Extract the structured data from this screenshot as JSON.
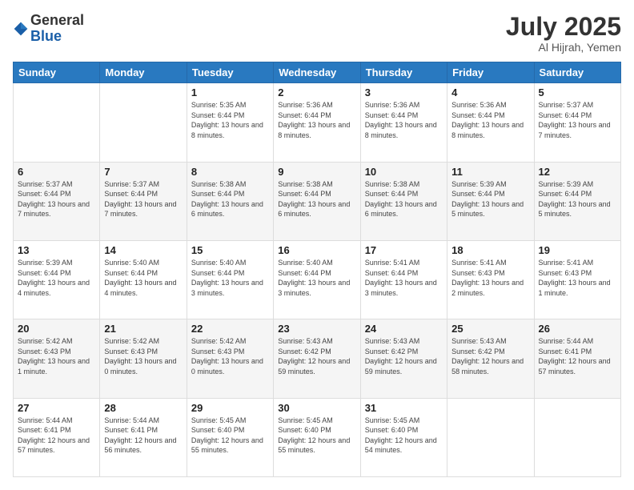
{
  "header": {
    "logo_general": "General",
    "logo_blue": "Blue",
    "month_year": "July 2025",
    "location": "Al Hijrah, Yemen"
  },
  "calendar": {
    "days_of_week": [
      "Sunday",
      "Monday",
      "Tuesday",
      "Wednesday",
      "Thursday",
      "Friday",
      "Saturday"
    ],
    "weeks": [
      [
        {
          "day": "",
          "info": ""
        },
        {
          "day": "",
          "info": ""
        },
        {
          "day": "1",
          "info": "Sunrise: 5:35 AM\nSunset: 6:44 PM\nDaylight: 13 hours and 8 minutes."
        },
        {
          "day": "2",
          "info": "Sunrise: 5:36 AM\nSunset: 6:44 PM\nDaylight: 13 hours and 8 minutes."
        },
        {
          "day": "3",
          "info": "Sunrise: 5:36 AM\nSunset: 6:44 PM\nDaylight: 13 hours and 8 minutes."
        },
        {
          "day": "4",
          "info": "Sunrise: 5:36 AM\nSunset: 6:44 PM\nDaylight: 13 hours and 8 minutes."
        },
        {
          "day": "5",
          "info": "Sunrise: 5:37 AM\nSunset: 6:44 PM\nDaylight: 13 hours and 7 minutes."
        }
      ],
      [
        {
          "day": "6",
          "info": "Sunrise: 5:37 AM\nSunset: 6:44 PM\nDaylight: 13 hours and 7 minutes."
        },
        {
          "day": "7",
          "info": "Sunrise: 5:37 AM\nSunset: 6:44 PM\nDaylight: 13 hours and 7 minutes."
        },
        {
          "day": "8",
          "info": "Sunrise: 5:38 AM\nSunset: 6:44 PM\nDaylight: 13 hours and 6 minutes."
        },
        {
          "day": "9",
          "info": "Sunrise: 5:38 AM\nSunset: 6:44 PM\nDaylight: 13 hours and 6 minutes."
        },
        {
          "day": "10",
          "info": "Sunrise: 5:38 AM\nSunset: 6:44 PM\nDaylight: 13 hours and 6 minutes."
        },
        {
          "day": "11",
          "info": "Sunrise: 5:39 AM\nSunset: 6:44 PM\nDaylight: 13 hours and 5 minutes."
        },
        {
          "day": "12",
          "info": "Sunrise: 5:39 AM\nSunset: 6:44 PM\nDaylight: 13 hours and 5 minutes."
        }
      ],
      [
        {
          "day": "13",
          "info": "Sunrise: 5:39 AM\nSunset: 6:44 PM\nDaylight: 13 hours and 4 minutes."
        },
        {
          "day": "14",
          "info": "Sunrise: 5:40 AM\nSunset: 6:44 PM\nDaylight: 13 hours and 4 minutes."
        },
        {
          "day": "15",
          "info": "Sunrise: 5:40 AM\nSunset: 6:44 PM\nDaylight: 13 hours and 3 minutes."
        },
        {
          "day": "16",
          "info": "Sunrise: 5:40 AM\nSunset: 6:44 PM\nDaylight: 13 hours and 3 minutes."
        },
        {
          "day": "17",
          "info": "Sunrise: 5:41 AM\nSunset: 6:44 PM\nDaylight: 13 hours and 3 minutes."
        },
        {
          "day": "18",
          "info": "Sunrise: 5:41 AM\nSunset: 6:43 PM\nDaylight: 13 hours and 2 minutes."
        },
        {
          "day": "19",
          "info": "Sunrise: 5:41 AM\nSunset: 6:43 PM\nDaylight: 13 hours and 1 minute."
        }
      ],
      [
        {
          "day": "20",
          "info": "Sunrise: 5:42 AM\nSunset: 6:43 PM\nDaylight: 13 hours and 1 minute."
        },
        {
          "day": "21",
          "info": "Sunrise: 5:42 AM\nSunset: 6:43 PM\nDaylight: 13 hours and 0 minutes."
        },
        {
          "day": "22",
          "info": "Sunrise: 5:42 AM\nSunset: 6:43 PM\nDaylight: 13 hours and 0 minutes."
        },
        {
          "day": "23",
          "info": "Sunrise: 5:43 AM\nSunset: 6:42 PM\nDaylight: 12 hours and 59 minutes."
        },
        {
          "day": "24",
          "info": "Sunrise: 5:43 AM\nSunset: 6:42 PM\nDaylight: 12 hours and 59 minutes."
        },
        {
          "day": "25",
          "info": "Sunrise: 5:43 AM\nSunset: 6:42 PM\nDaylight: 12 hours and 58 minutes."
        },
        {
          "day": "26",
          "info": "Sunrise: 5:44 AM\nSunset: 6:41 PM\nDaylight: 12 hours and 57 minutes."
        }
      ],
      [
        {
          "day": "27",
          "info": "Sunrise: 5:44 AM\nSunset: 6:41 PM\nDaylight: 12 hours and 57 minutes."
        },
        {
          "day": "28",
          "info": "Sunrise: 5:44 AM\nSunset: 6:41 PM\nDaylight: 12 hours and 56 minutes."
        },
        {
          "day": "29",
          "info": "Sunrise: 5:45 AM\nSunset: 6:40 PM\nDaylight: 12 hours and 55 minutes."
        },
        {
          "day": "30",
          "info": "Sunrise: 5:45 AM\nSunset: 6:40 PM\nDaylight: 12 hours and 55 minutes."
        },
        {
          "day": "31",
          "info": "Sunrise: 5:45 AM\nSunset: 6:40 PM\nDaylight: 12 hours and 54 minutes."
        },
        {
          "day": "",
          "info": ""
        },
        {
          "day": "",
          "info": ""
        }
      ]
    ]
  }
}
